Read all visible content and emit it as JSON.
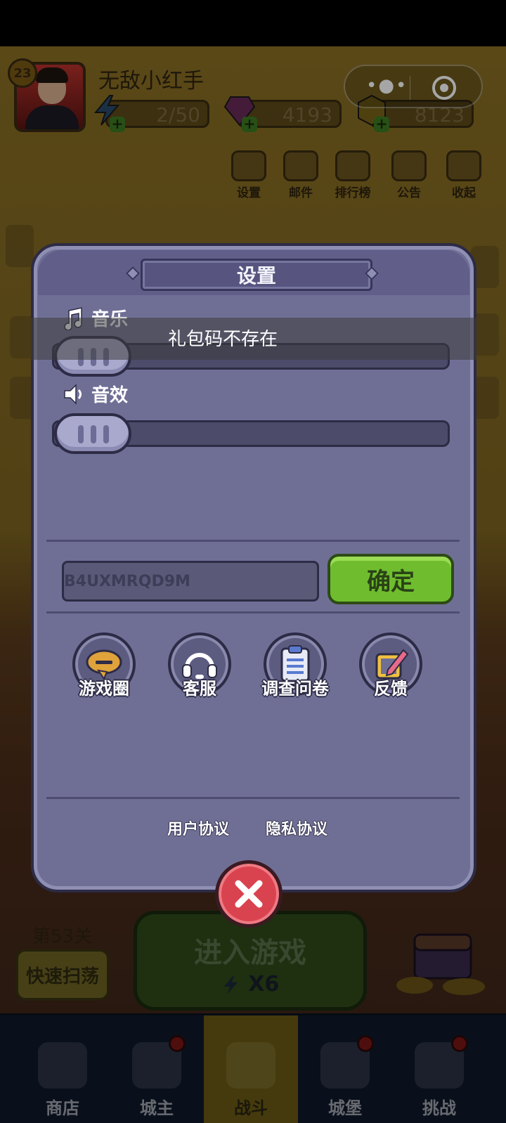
{
  "player": {
    "level": "23",
    "name": "无敌小红手"
  },
  "resources": {
    "energy": "2/50",
    "gems": "4193",
    "gold": "8123"
  },
  "top_buttons": [
    "设置",
    "邮件",
    "排行榜",
    "公告",
    "收起"
  ],
  "stage": {
    "label": "第53关",
    "sweep": "快速扫荡",
    "enter": "进入游戏",
    "cost": "X6"
  },
  "nav": [
    "商店",
    "城主",
    "战斗",
    "城堡",
    "挑战"
  ],
  "dialog": {
    "title": "设置",
    "music_label": "音乐",
    "music_level": 0,
    "sfx_label": "音效",
    "sfx_level": 0,
    "gift_code_value": "B4UXMRQD9M",
    "toast": "礼包码不存在",
    "confirm": "确定",
    "actions": [
      "游戏圈",
      "客服",
      "调查问卷",
      "反馈"
    ],
    "links": {
      "user_agreement": "用户协议",
      "privacy_policy": "隐私协议"
    }
  },
  "colors": {
    "confirm_green": "#6fbd2e",
    "close_red": "#d9434f",
    "dialog_bg": "#6f6f96"
  }
}
